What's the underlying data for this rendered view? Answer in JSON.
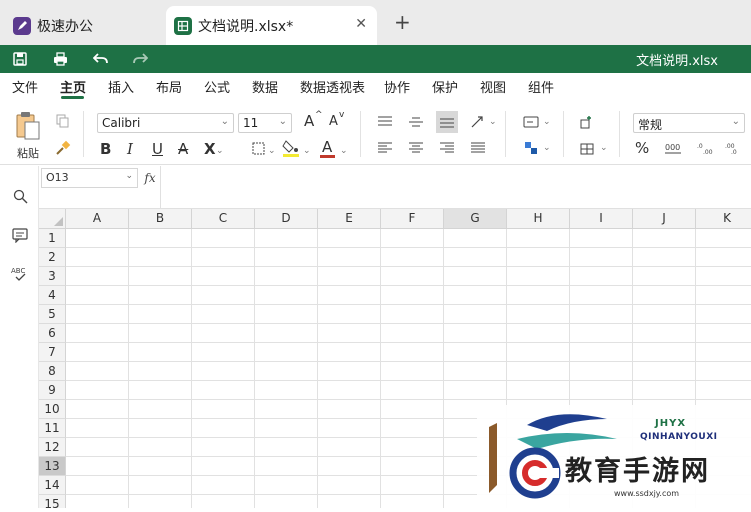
{
  "tabs": [
    {
      "label": "极速办公",
      "icon": "rocket-app-icon"
    },
    {
      "label": "文档说明.xlsx*",
      "icon": "spreadsheet-icon",
      "active": true
    }
  ],
  "new_tab_label": "+",
  "close_tab_label": "✕",
  "title_bar": {
    "document_title": "文档说明.xlsx",
    "color": "#1e7145"
  },
  "menu": [
    "文件",
    "主页",
    "插入",
    "布局",
    "公式",
    "数据",
    "数据透视表",
    "协作",
    "保护",
    "视图",
    "组件"
  ],
  "active_menu": "主页",
  "ribbon": {
    "paste_label": "粘贴",
    "font_name": "Calibri",
    "font_size": "11",
    "number_format": "常规",
    "bold": "B",
    "italic": "I",
    "underline": "U",
    "strikethrough": "A",
    "subscript": "X",
    "font_color_label": "A",
    "grow_font": "A",
    "shrink_font": "A",
    "percent": "%"
  },
  "formula_bar": {
    "cell_ref": "O13",
    "fx_label": "fx",
    "formula": ""
  },
  "grid": {
    "columns": [
      "A",
      "B",
      "C",
      "D",
      "E",
      "F",
      "G",
      "H",
      "I",
      "J",
      "K"
    ],
    "rows": [
      "1",
      "2",
      "3",
      "4",
      "5",
      "6",
      "7",
      "8",
      "9",
      "10",
      "11",
      "12",
      "13",
      "14",
      "15"
    ],
    "selected_column": "G",
    "selected_row": "13"
  },
  "watermark": {
    "text": "教育手游网",
    "url": "www.ssdxjy.com",
    "brand": "QINHANYOUXI",
    "brand_box": "JHYX"
  }
}
